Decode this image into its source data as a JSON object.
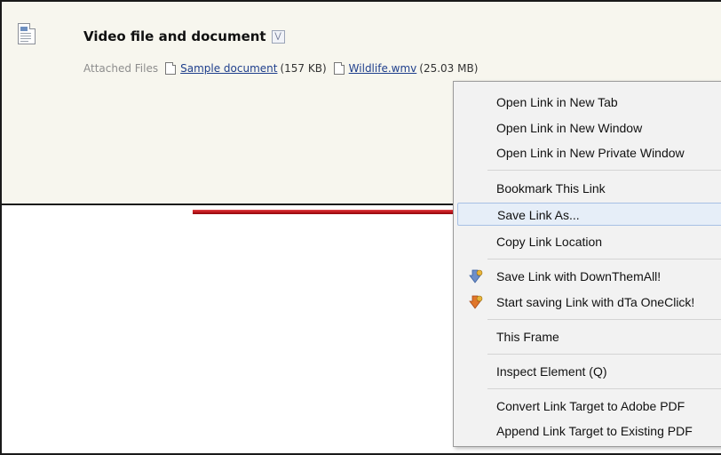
{
  "post": {
    "title": "Video file and document",
    "attachments_label": "Attached Files",
    "attachments": [
      {
        "name": "Sample document",
        "size": "(157 KB)"
      },
      {
        "name": "Wildlife.wmv",
        "size": "(25.03 MB)"
      }
    ]
  },
  "context_menu": {
    "items": [
      {
        "label": "Open Link in New Tab"
      },
      {
        "label": "Open Link in New Window"
      },
      {
        "label": "Open Link in New Private Window"
      },
      {
        "label": "Bookmark This Link"
      },
      {
        "label": "Save Link As...",
        "highlighted": true
      },
      {
        "label": "Copy Link Location"
      },
      {
        "label": "Save Link with DownThemAll!",
        "icon": "downthemall-icon"
      },
      {
        "label": "Start saving Link with dTa OneClick!",
        "icon": "dta-oneclick-icon"
      },
      {
        "label": "This Frame"
      },
      {
        "label": "Inspect Element (Q)"
      },
      {
        "label": "Convert Link Target to Adobe PDF"
      },
      {
        "label": "Append Link Target to Existing PDF"
      }
    ]
  },
  "annotation": {
    "arrow_color": "#c0161c"
  }
}
